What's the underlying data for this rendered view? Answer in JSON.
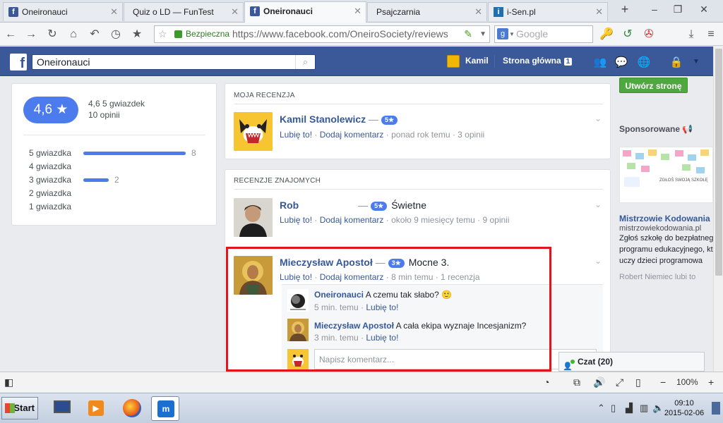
{
  "browser": {
    "tabs": [
      {
        "title": "Oneironauci",
        "favicon": "facebook-icon",
        "active": false
      },
      {
        "title": "Quiz o LD — FunTest",
        "favicon": "none",
        "active": false
      },
      {
        "title": "Oneironauci",
        "favicon": "facebook-icon",
        "active": true
      },
      {
        "title": "Psajczarnia",
        "favicon": "none",
        "active": false
      },
      {
        "title": "i-Sen.pl",
        "favicon": "isen-icon",
        "active": false
      }
    ],
    "secure_label": "Bezpieczna",
    "url": "https://www.facebook.com/OneiroSociety/reviews",
    "search_engine": "Google",
    "search_placeholder": "Google",
    "new_tab": "+"
  },
  "facebook": {
    "logo": "f",
    "search_value": "Oneironauci",
    "user_name": "Kamil",
    "home_label": "Strona główna",
    "home_badge": "1"
  },
  "rating_summary": {
    "score": "4,6 ★",
    "stars_text": "4,6 5 gwiazdek",
    "count_text": "10 opinii",
    "rows": [
      {
        "label": "5 gwiazdka",
        "count": "8",
        "value": 8
      },
      {
        "label": "4 gwiazdka",
        "count": "",
        "value": 0
      },
      {
        "label": "3 gwiazdka",
        "count": "2",
        "value": 2
      },
      {
        "label": "2 gwiazdka",
        "count": "",
        "value": 0
      },
      {
        "label": "1 gwiazdka",
        "count": "",
        "value": 0
      }
    ]
  },
  "my_review": {
    "header": "MOJA RECENZJA",
    "name": "Kamil Stanolewicz",
    "dash": " —",
    "badge": "5★",
    "like": "Lubię to!",
    "sep1": " · ",
    "comment": "Dodaj komentarz",
    "meta": " · ponad rok temu · 3 opinii"
  },
  "friends_reviews": {
    "header": "RECENZJE ZNAJOMYCH",
    "items": [
      {
        "name": "Rob",
        "dash": " —",
        "badge": "5★",
        "text": "Świetne",
        "like": "Lubię to!",
        "sep": " · ",
        "comment": "Dodaj komentarz",
        "meta": " · około 9 miesięcy temu · 9 opinii"
      },
      {
        "name": "Mieczysław Apostoł",
        "dash": " —",
        "badge": "3★",
        "text": "Mocne 3.",
        "like": "Lubię to!",
        "sep": " · ",
        "comment": "Dodaj komentarz",
        "meta": " · 8 min temu · 1 recenzja"
      }
    ],
    "comments": [
      {
        "name": "Oneironauci",
        "text": " A czemu tak słabo? 🙂",
        "time": "5 min. temu",
        "sep": " · ",
        "like": "Lubię to!"
      },
      {
        "name": "Mieczysław Apostoł",
        "text": " A cała ekipa wyznaje Incesjanizm?",
        "time": "3 min. temu",
        "sep": " · ",
        "like": "Lubię to!"
      }
    ],
    "comment_placeholder": "Napisz komentarz..."
  },
  "right": {
    "create_page": "Utwórz stronę",
    "sponsored": "Sponsorowane",
    "ad_title": "Mistrzowie Kodowania",
    "ad_url": "mistrzowiekodowania.pl",
    "ad_lines": [
      "Zgłoś szkołę do bezpłatnego",
      "programu edukacyjnego, któ",
      "uczy dzieci programowa"
    ],
    "ad_like": "Robert Niemiec lubi to",
    "ad_img_text": "ZGŁOŚ SWOJĄ SZKOŁĘ"
  },
  "chat": {
    "label": "Czat (20)"
  },
  "statusbar": {
    "zoom": "100%"
  },
  "taskbar": {
    "start": "Start",
    "time": "09:10",
    "date": "2015-02-06"
  }
}
